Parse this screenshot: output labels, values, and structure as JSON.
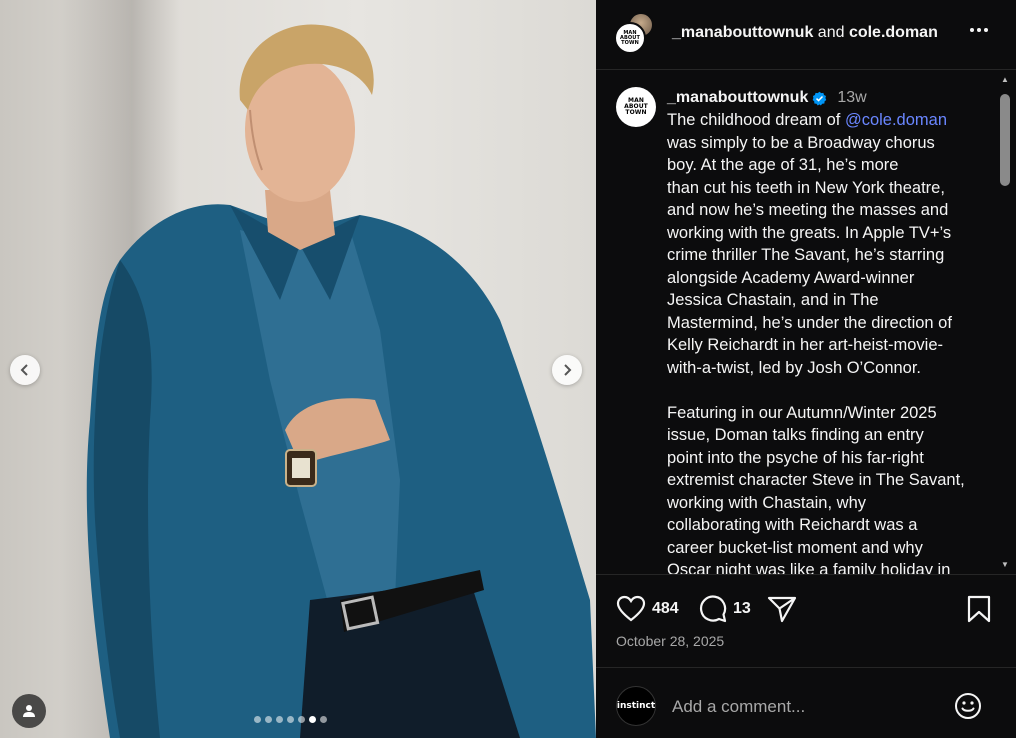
{
  "header": {
    "user1": "_manabouttownuk",
    "joiner": " and ",
    "user2": "cole.doman",
    "logo_text": "MAN ABOUT TOWN"
  },
  "photo": {
    "slide_count": 7,
    "active_slide": 6
  },
  "caption": {
    "username": "_manabouttownuk",
    "verified": true,
    "time": "13w",
    "text_before_mention": "The childhood dream of ",
    "mention": "@cole.doman",
    "text_after_mention": "\nwas simply to be a Broadway chorus\nboy. At the age of 31, he’s more\nthan cut his teeth in New York theatre,\nand now he’s meeting the masses and\nworking with the greats. In Apple TV+’s\ncrime thriller The Savant, he’s starring\nalongside Academy Award-winner\nJessica Chastain, and in The\nMastermind, he’s under the direction of\nKelly Reichardt in her art-heist-movie-\nwith-a-twist, led by Josh O’Connor.\n\nFeaturing in our Autumn/Winter 2025\nissue, Doman talks finding an entry\npoint into the psyche of his far-right\nextremist character Steve in The Savant,\nworking with Chastain, why\ncollaborating with Reichardt was a\ncareer bucket-list moment and why\nOscar night was like a family holiday in"
  },
  "actions": {
    "likes": "484",
    "comments": "13",
    "date": "October 28, 2025"
  },
  "comment_bar": {
    "avatar_text": "instinct",
    "placeholder": "Add a comment..."
  },
  "colors": {
    "panel_bg": "#0c0c0d",
    "mention": "#6a86ff",
    "verified": "#0095f6",
    "muted": "#a8a8a8"
  }
}
